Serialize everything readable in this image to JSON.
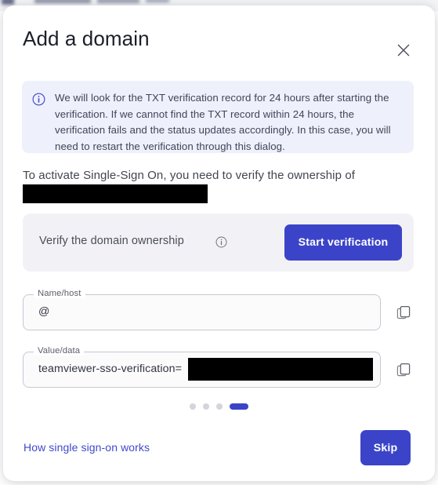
{
  "colors": {
    "accent": "#3b44c8",
    "info_bg": "#eef0fb",
    "panel_bg": "#f2f2f6",
    "text": "#41455a",
    "link": "#4049cb",
    "redaction": "#000000"
  },
  "dialog": {
    "title": "Add a domain",
    "close_icon": "close-icon",
    "info_banner": {
      "icon": "info-circle-icon",
      "text": "We will look for the TXT verification record for 24 hours after starting the verification. If we cannot find the TXT record within 24 hours, the verification fails and the status updates accordingly. In this case, you will need to restart the verification through this dialog."
    },
    "activation": {
      "text": "To activate Single-Sign On, you need to verify the ownership of",
      "domain_redacted": ""
    },
    "verify_panel": {
      "label": "Verify the domain ownership",
      "info_icon": "info-circle-icon",
      "button_label": "Start verification"
    },
    "fields": [
      {
        "legend": "Name/host",
        "value": "@",
        "redacted": false,
        "copy_icon": "copy-icon"
      },
      {
        "legend": "Value/data",
        "value": "teamviewer-sso-verification=",
        "redacted": true,
        "copy_icon": "copy-icon"
      }
    ],
    "pagination": {
      "total": 4,
      "active_index": 4
    },
    "footer": {
      "link_label": "How single sign-on works",
      "skip_label": "Skip"
    }
  }
}
